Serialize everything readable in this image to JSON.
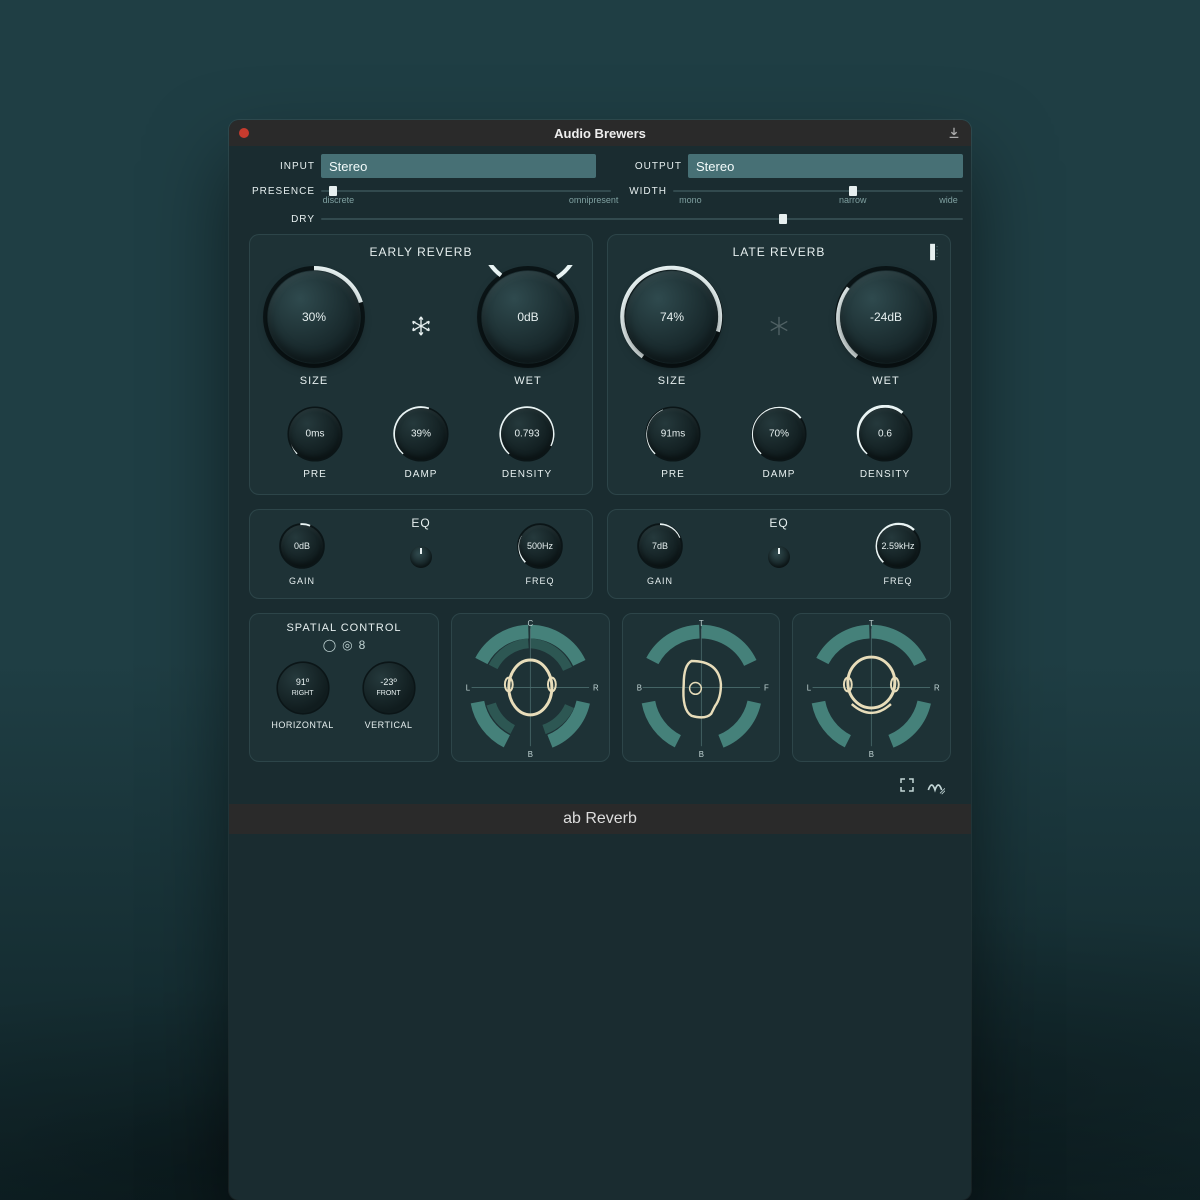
{
  "title": "Audio Brewers",
  "product": "ab Reverb",
  "io": {
    "input_label": "INPUT",
    "input_value": "Stereo",
    "output_label": "OUTPUT",
    "output_value": "Stereo"
  },
  "presence": {
    "label": "PRESENCE",
    "tick_left": "discrete",
    "tick_right": "omnipresent",
    "value_pct": 5
  },
  "width": {
    "label": "WIDTH",
    "tick_left": "mono",
    "tick_mid": "narrow",
    "tick_right": "wide",
    "value_pct": 62
  },
  "dry": {
    "label": "DRY",
    "value_pct": 72
  },
  "early": {
    "title": "EARLY REVERB",
    "size": {
      "value": "30%",
      "label": "SIZE",
      "angle": -80
    },
    "wet": {
      "value": "0dB",
      "label": "WET",
      "angle": 120
    },
    "freeze_active": true,
    "pre": {
      "value": "0ms",
      "label": "PRE",
      "angle": -125
    },
    "damp": {
      "value": "39%",
      "label": "DAMP",
      "angle": -25
    },
    "density": {
      "value": "0.793",
      "label": "DENSITY",
      "angle": 85
    }
  },
  "late": {
    "title": "LATE REVERB",
    "size": {
      "value": "74%",
      "label": "SIZE",
      "angle": 60
    },
    "wet": {
      "value": "-24dB",
      "label": "WET",
      "angle": -62
    },
    "freeze_active": false,
    "pre": {
      "value": "91ms",
      "label": "PRE",
      "angle": -80
    },
    "damp": {
      "value": "70%",
      "label": "DAMP",
      "angle": 60
    },
    "density": {
      "value": "0.6",
      "label": "DENSITY",
      "angle": 30
    }
  },
  "eq_early": {
    "title": "EQ",
    "gain": {
      "value": "0dB",
      "label": "GAIN",
      "angle": 0
    },
    "freq": {
      "value": "500Hz",
      "label": "FREQ",
      "angle": -90
    }
  },
  "eq_late": {
    "title": "EQ",
    "gain": {
      "value": "7dB",
      "label": "GAIN",
      "angle": 70
    },
    "freq": {
      "value": "2.59kHz",
      "label": "FREQ",
      "angle": 40
    }
  },
  "spatial": {
    "title": "SPATIAL CONTROL",
    "horizontal": {
      "value": "91º",
      "sub": "RIGHT",
      "label": "HORIZONTAL"
    },
    "vertical": {
      "value": "-23º",
      "sub": "FRONT",
      "label": "VERTICAL"
    }
  },
  "viz": {
    "axes": {
      "c": "C",
      "l": "L",
      "r": "R",
      "b": "B",
      "t": "T",
      "f": "F"
    }
  },
  "icons": {
    "close": "close-icon",
    "download": "download-icon",
    "freeze": "snowflake-icon",
    "link": "link-indicator-icon",
    "fullscreen": "fullscreen-icon",
    "logo": "brand-logo-icon"
  }
}
